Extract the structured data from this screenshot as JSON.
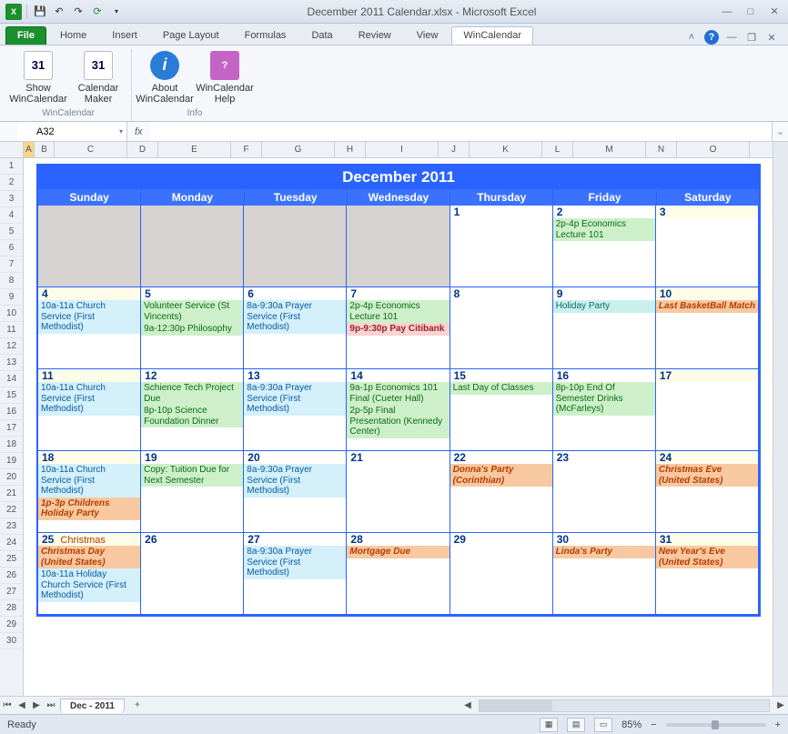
{
  "window": {
    "title": "December 2011 Calendar.xlsx  -  Microsoft Excel"
  },
  "ribbon": {
    "tabs": [
      "File",
      "Home",
      "Insert",
      "Page Layout",
      "Formulas",
      "Data",
      "Review",
      "View",
      "WinCalendar"
    ],
    "groups": {
      "wincalendar": {
        "label": "WinCalendar",
        "btn1": "Show WinCalendar",
        "btn2": "Calendar Maker"
      },
      "info": {
        "label": "Info",
        "btn1": "About WinCalendar",
        "btn2": "WinCalendar Help"
      }
    }
  },
  "formula": {
    "namebox": "A32",
    "fx": "fx",
    "value": ""
  },
  "columns": [
    "A",
    "B",
    "C",
    "D",
    "E",
    "F",
    "G",
    "H",
    "I",
    "J",
    "K",
    "L",
    "M",
    "N",
    "O"
  ],
  "rows_count": 30,
  "calendar": {
    "title": "December 2011",
    "days": [
      "Sunday",
      "Monday",
      "Tuesday",
      "Wednesday",
      "Thursday",
      "Friday",
      "Saturday"
    ],
    "weeks": [
      [
        {
          "grey": true
        },
        {
          "grey": true
        },
        {
          "grey": true
        },
        {
          "grey": true
        },
        {
          "num": "1"
        },
        {
          "num": "2",
          "events": [
            {
              "cls": "green",
              "text": "2p-4p Economics Lecture 101"
            }
          ]
        },
        {
          "num": "3",
          "alt": true
        }
      ],
      [
        {
          "num": "4",
          "alt": true,
          "events": [
            {
              "cls": "blue",
              "text": "10a-11a Church Service (First Methodist)"
            }
          ]
        },
        {
          "num": "5",
          "events": [
            {
              "cls": "green",
              "text": " Volunteer Service (St Vincents)"
            },
            {
              "cls": "green",
              "text": "9a-12:30p Philosophy"
            }
          ]
        },
        {
          "num": "6",
          "events": [
            {
              "cls": "blue",
              "text": "8a-9:30a Prayer Service (First Methodist)"
            }
          ]
        },
        {
          "num": "7",
          "events": [
            {
              "cls": "green",
              "text": "2p-4p Economics Lecture 101"
            },
            {
              "cls": "pink",
              "text": "9p-9:30p Pay Citibank"
            }
          ]
        },
        {
          "num": "8"
        },
        {
          "num": "9",
          "events": [
            {
              "cls": "teal",
              "text": " Holiday Party"
            }
          ]
        },
        {
          "num": "10",
          "alt": true,
          "events": [
            {
              "cls": "orange",
              "text": " Last BasketBall Match"
            }
          ]
        }
      ],
      [
        {
          "num": "11",
          "alt": true,
          "events": [
            {
              "cls": "blue",
              "text": "10a-11a Church Service (First Methodist)"
            }
          ]
        },
        {
          "num": "12",
          "events": [
            {
              "cls": "green",
              "text": " Schience Tech Project Due"
            },
            {
              "cls": "green",
              "text": "8p-10p Science Foundation Dinner"
            }
          ]
        },
        {
          "num": "13",
          "events": [
            {
              "cls": "blue",
              "text": "8a-9:30a Prayer Service (First Methodist)"
            }
          ]
        },
        {
          "num": "14",
          "events": [
            {
              "cls": "green",
              "text": "9a-1p Economics 101 Final (Cueter Hall)"
            },
            {
              "cls": "green",
              "text": "2p-5p Final Presentation (Kennedy Center)"
            }
          ]
        },
        {
          "num": "15",
          "events": [
            {
              "cls": "green",
              "text": " Last Day of Classes"
            }
          ]
        },
        {
          "num": "16",
          "events": [
            {
              "cls": "green",
              "text": "8p-10p End Of Semester Drinks (McFarleys)"
            }
          ]
        },
        {
          "num": "17",
          "alt": true
        }
      ],
      [
        {
          "num": "18",
          "alt": true,
          "events": [
            {
              "cls": "blue",
              "text": "10a-11a Church Service (First Methodist)"
            },
            {
              "cls": "orange",
              "text": "1p-3p Childrens Holiday Party"
            }
          ]
        },
        {
          "num": "19",
          "events": [
            {
              "cls": "green",
              "text": " Copy: Tuition Due for Next Semester"
            }
          ]
        },
        {
          "num": "20",
          "events": [
            {
              "cls": "blue",
              "text": "8a-9:30a Prayer Service (First Methodist)"
            }
          ]
        },
        {
          "num": "21"
        },
        {
          "num": "22",
          "events": [
            {
              "cls": "orange",
              "text": " Donna's Party (Corinthian)"
            }
          ]
        },
        {
          "num": "23"
        },
        {
          "num": "24",
          "alt": true,
          "events": [
            {
              "cls": "orange",
              "text": " Christmas Eve (United States)"
            }
          ]
        }
      ],
      [
        {
          "num": "25",
          "alt": true,
          "holiday": "Christmas",
          "events": [
            {
              "cls": "orange",
              "text": " Christmas Day (United States)"
            },
            {
              "cls": "blue",
              "text": "10a-11a Holiday Church Service (First Methodist)"
            }
          ]
        },
        {
          "num": "26"
        },
        {
          "num": "27",
          "events": [
            {
              "cls": "blue",
              "text": "8a-9:30a Prayer Service (First Methodist)"
            }
          ]
        },
        {
          "num": "28",
          "events": [
            {
              "cls": "orange",
              "text": " Mortgage Due"
            }
          ]
        },
        {
          "num": "29"
        },
        {
          "num": "30",
          "events": [
            {
              "cls": "orange",
              "text": " Linda's Party"
            }
          ]
        },
        {
          "num": "31",
          "alt": true,
          "events": [
            {
              "cls": "orange",
              "text": " New Year's Eve (United States)"
            }
          ]
        }
      ]
    ]
  },
  "sheettab": "Dec - 2011",
  "status": {
    "ready": "Ready",
    "zoom": "85%"
  }
}
